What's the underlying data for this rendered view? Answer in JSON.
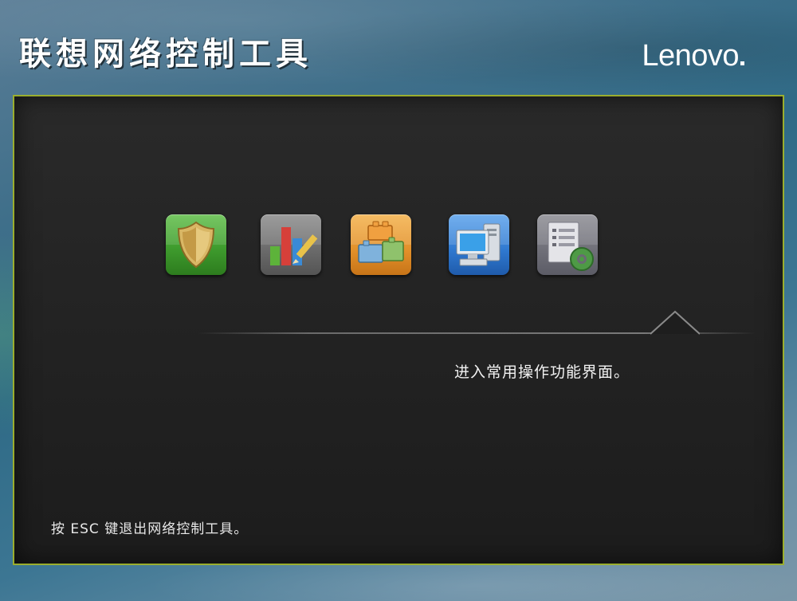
{
  "window": {
    "title": "联想网络控制工具",
    "brand": "Lenovo"
  },
  "toolbar": {
    "icons": [
      {
        "name": "security-shield-icon",
        "color": "#3f9c2e"
      },
      {
        "name": "statistics-chart-icon",
        "color": "#6a6a6a"
      },
      {
        "name": "modules-blocks-icon",
        "color": "#e2902a"
      },
      {
        "name": "network-computer-icon",
        "color": "#2f78cf"
      },
      {
        "name": "settings-document-icon",
        "color": "#6f6f78"
      }
    ],
    "selected_index": 4
  },
  "main": {
    "description": "进入常用操作功能界面。"
  },
  "footer": {
    "hint": "按 ESC 键退出网络控制工具。"
  },
  "colors": {
    "panel_border": "#9aae2e",
    "panel_background": "#242424",
    "frame": "#2f6a86"
  }
}
